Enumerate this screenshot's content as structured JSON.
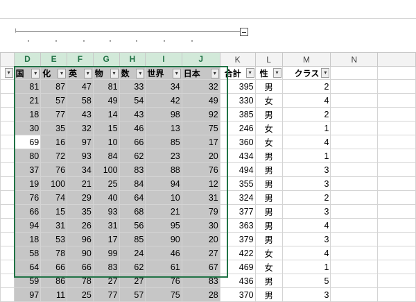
{
  "columns": [
    "D",
    "E",
    "F",
    "G",
    "H",
    "I",
    "J",
    "K",
    "L",
    "M",
    "N"
  ],
  "headers": [
    "国語",
    "化学",
    "英語",
    "物理",
    "数学",
    "世界史",
    "日本史",
    "合計",
    "性別",
    "クラス"
  ],
  "headers_visible": [
    "国",
    "化",
    "英",
    "物",
    "数",
    "世界",
    "日本",
    "合計",
    "性",
    "クラス"
  ],
  "rows": [
    [
      "81",
      "87",
      "47",
      "81",
      "33",
      "34",
      "32",
      "395",
      "男",
      "2"
    ],
    [
      "21",
      "57",
      "58",
      "49",
      "54",
      "42",
      "49",
      "330",
      "女",
      "4"
    ],
    [
      "18",
      "77",
      "43",
      "14",
      "43",
      "98",
      "92",
      "385",
      "男",
      "2"
    ],
    [
      "30",
      "35",
      "32",
      "15",
      "46",
      "13",
      "75",
      "246",
      "女",
      "1"
    ],
    [
      "69",
      "16",
      "97",
      "10",
      "66",
      "85",
      "17",
      "360",
      "女",
      "4"
    ],
    [
      "80",
      "72",
      "93",
      "84",
      "62",
      "23",
      "20",
      "434",
      "男",
      "1"
    ],
    [
      "37",
      "76",
      "34",
      "100",
      "83",
      "88",
      "76",
      "494",
      "男",
      "3"
    ],
    [
      "19",
      "100",
      "21",
      "25",
      "84",
      "94",
      "12",
      "355",
      "男",
      "3"
    ],
    [
      "76",
      "74",
      "29",
      "40",
      "64",
      "10",
      "31",
      "324",
      "男",
      "2"
    ],
    [
      "66",
      "15",
      "35",
      "93",
      "68",
      "21",
      "79",
      "377",
      "男",
      "3"
    ],
    [
      "94",
      "31",
      "26",
      "31",
      "56",
      "95",
      "30",
      "363",
      "男",
      "4"
    ],
    [
      "18",
      "53",
      "96",
      "17",
      "85",
      "90",
      "20",
      "379",
      "男",
      "3"
    ],
    [
      "58",
      "78",
      "90",
      "99",
      "24",
      "46",
      "27",
      "422",
      "女",
      "4"
    ],
    [
      "64",
      "66",
      "66",
      "83",
      "62",
      "61",
      "67",
      "469",
      "女",
      "1"
    ],
    [
      "59",
      "86",
      "78",
      "27",
      "27",
      "76",
      "83",
      "436",
      "男",
      "5"
    ],
    [
      "97",
      "11",
      "25",
      "77",
      "57",
      "75",
      "28",
      "370",
      "男",
      "3"
    ]
  ]
}
